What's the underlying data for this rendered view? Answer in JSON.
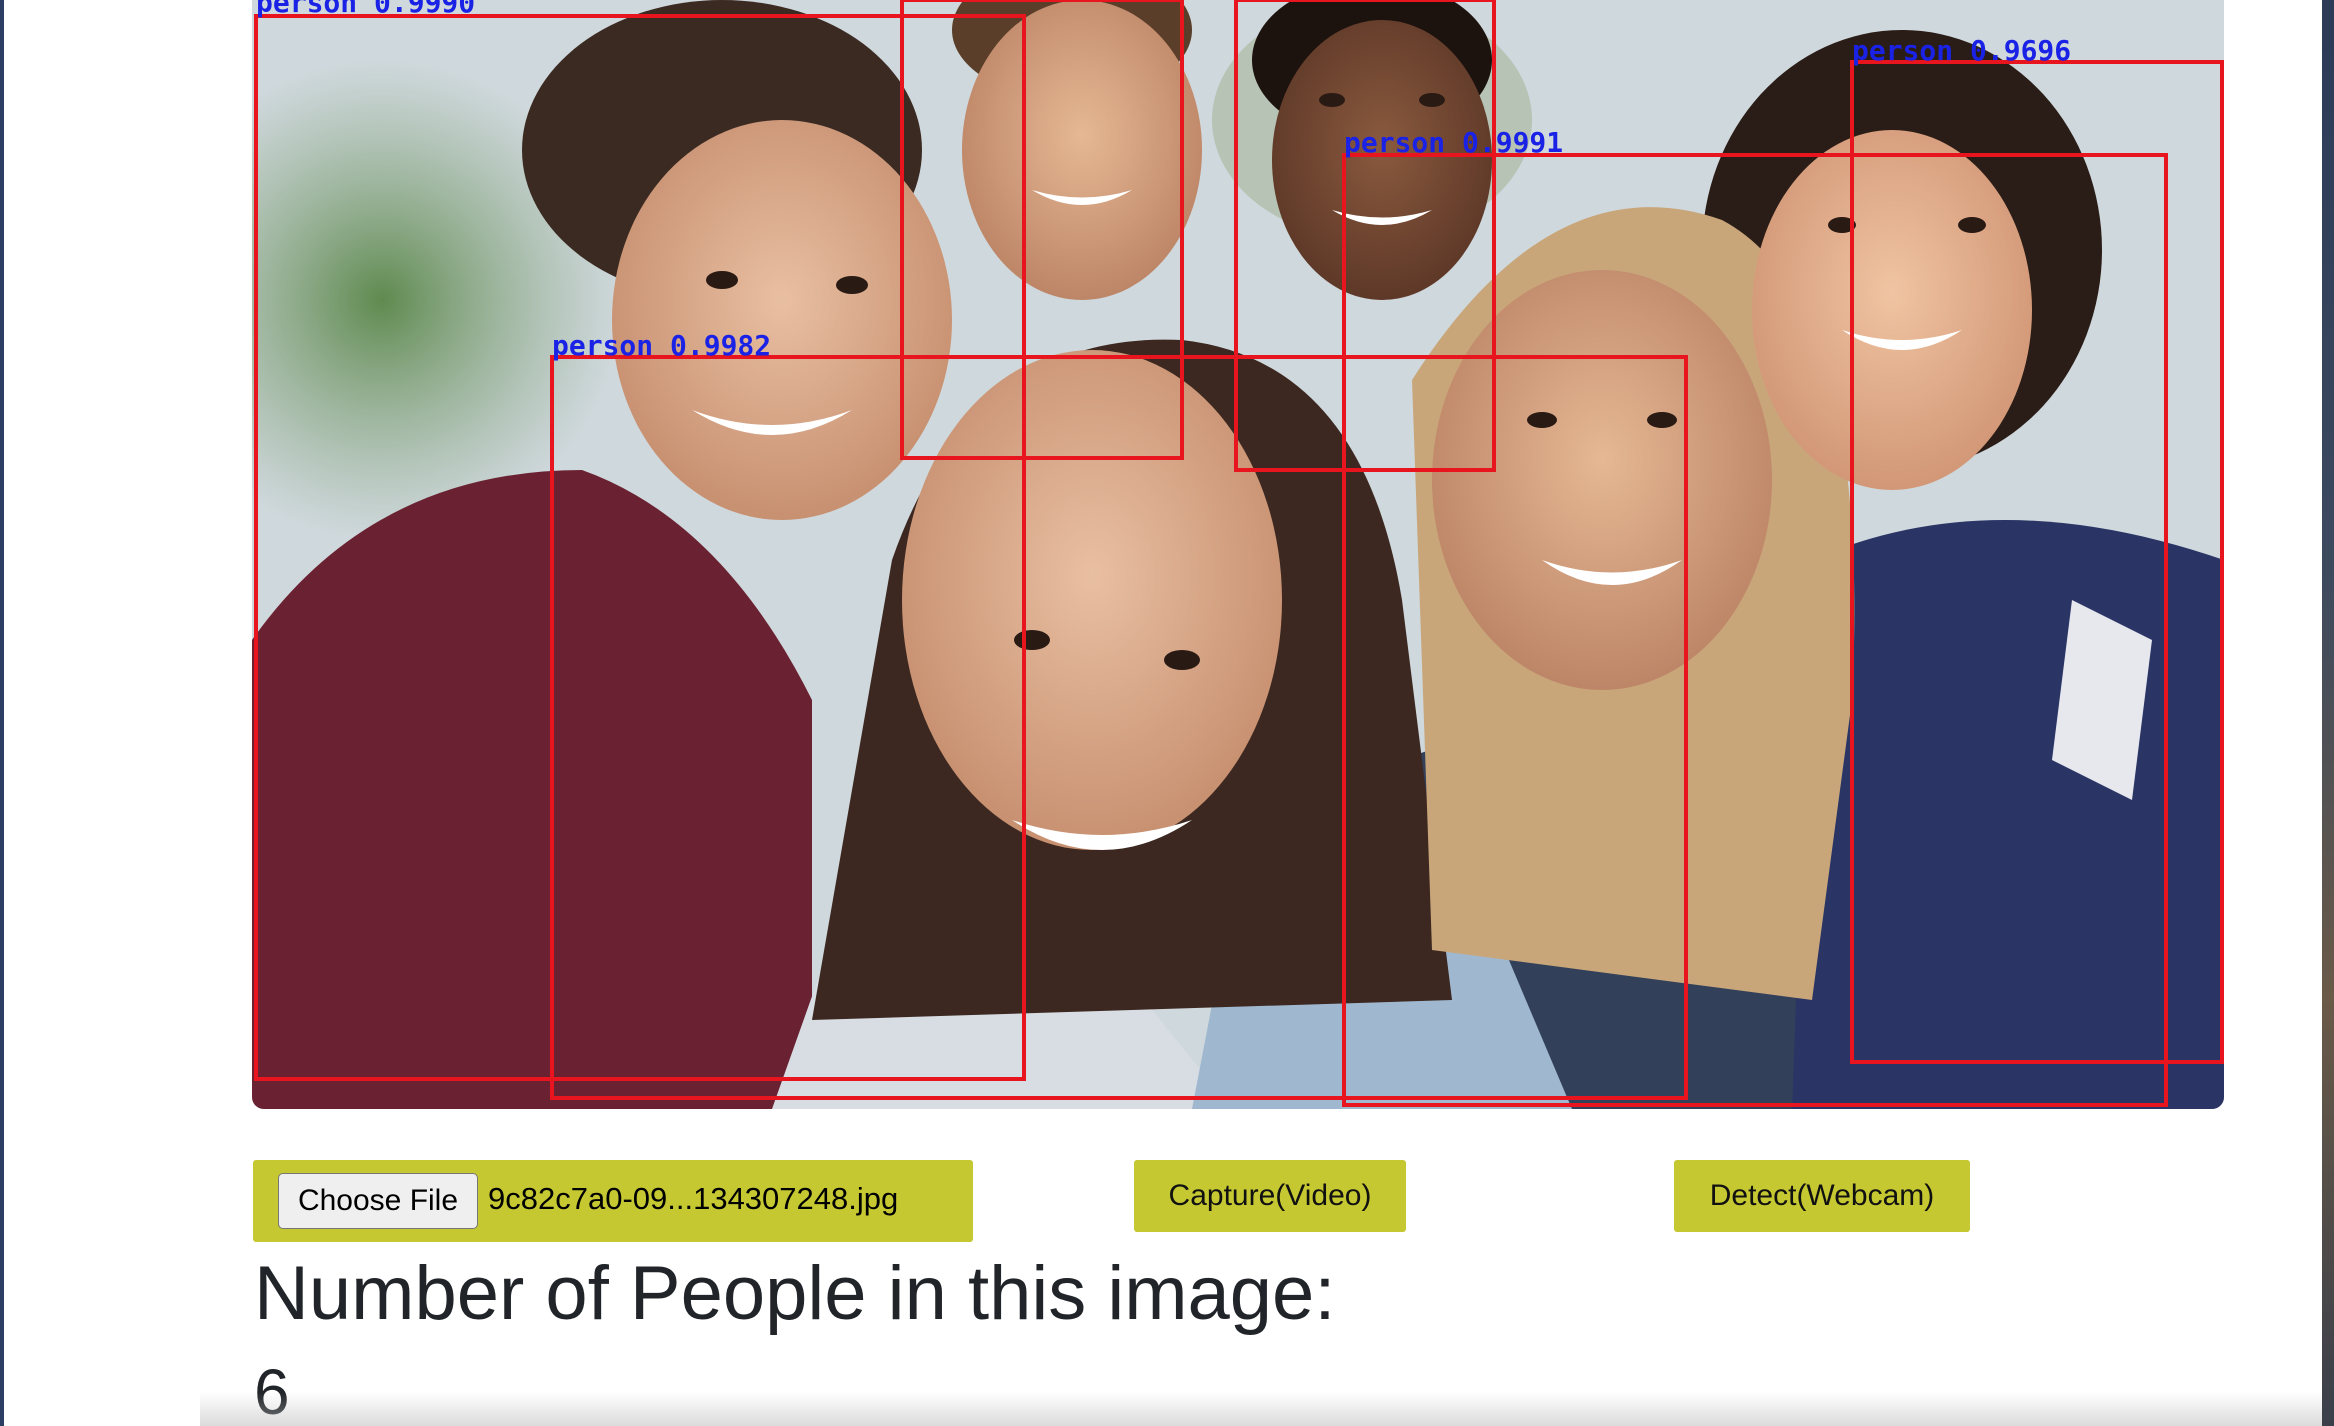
{
  "detections": [
    {
      "label": "person 0.9990"
    },
    {
      "label": "person 0.9982"
    },
    {
      "label": "person 0.9991"
    },
    {
      "label": "person 0.9696"
    }
  ],
  "colors": {
    "box": "#e8141e",
    "detection_label": "#1a22e6",
    "button": "#c6c832"
  },
  "controls": {
    "choose_file_label": "Choose File",
    "file_name": "9c82c7a0-09...134307248.jpg",
    "capture_label": "Capture(Video)",
    "detect_label": "Detect(Webcam)"
  },
  "result": {
    "heading": "Number of People in this image:",
    "count": "6"
  }
}
